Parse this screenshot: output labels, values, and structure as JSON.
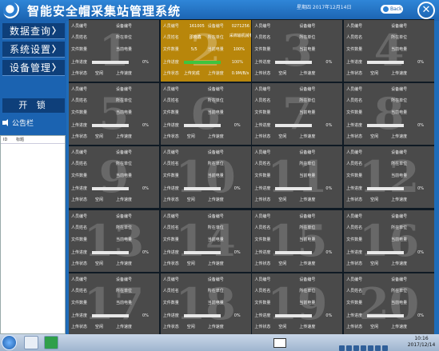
{
  "header": {
    "title": "智能安全帽采集站管理系统",
    "date": "星期四 2017年12月14日",
    "back_label": "Back",
    "close_symbol": "✕"
  },
  "sidebar": {
    "menu": [
      {
        "label": "数据查询",
        "arrow": "〉"
      },
      {
        "label": "系统设置",
        "arrow": "〉"
      },
      {
        "label": "设备管理",
        "arrow": "〉"
      }
    ],
    "unlock_label": "开 锁",
    "notice_title": "公告栏",
    "notice_columns": [
      "ID",
      "标题"
    ]
  },
  "card_labels": {
    "person_id": "人员编号",
    "device_id": "设备编号",
    "person_name": "人员姓名",
    "unit": "所在单位",
    "file_count": "文件数量",
    "battery": "当前电量",
    "upload_progress": "上传进度",
    "upload_status": "上传状态",
    "status_idle": "空闲",
    "upload_speed": "上传速度"
  },
  "cards": [
    {
      "num": "1"
    },
    {
      "num": "2",
      "active": true,
      "person_id": "161005",
      "device_id": "0271256",
      "person_name": "邵晓鑫",
      "unit": "采棉输机械有限公司",
      "file_count": "5/5",
      "battery": "100%",
      "upload_progress_pct": "100%",
      "progress": 1.0,
      "upload_status": "上传完成",
      "upload_speed": "0.9M/B/s"
    },
    {
      "num": "3"
    },
    {
      "num": "4"
    },
    {
      "num": "5"
    },
    {
      "num": "6"
    },
    {
      "num": "7"
    },
    {
      "num": "8"
    },
    {
      "num": "9"
    },
    {
      "num": "10"
    },
    {
      "num": "11"
    },
    {
      "num": "12"
    },
    {
      "num": "13"
    },
    {
      "num": "14"
    },
    {
      "num": "15"
    },
    {
      "num": "16"
    },
    {
      "num": "17"
    },
    {
      "num": "18"
    },
    {
      "num": "19"
    },
    {
      "num": "20"
    }
  ],
  "default_progress_pct": "0%",
  "taskbar": {
    "time": "10:16",
    "date": "2017/12/14"
  },
  "colors": {
    "header_blue": "#1f6cb8",
    "card_grey": "#4a4a4a",
    "card_active": "#b8860b",
    "progress_green": "#3fc43f"
  }
}
